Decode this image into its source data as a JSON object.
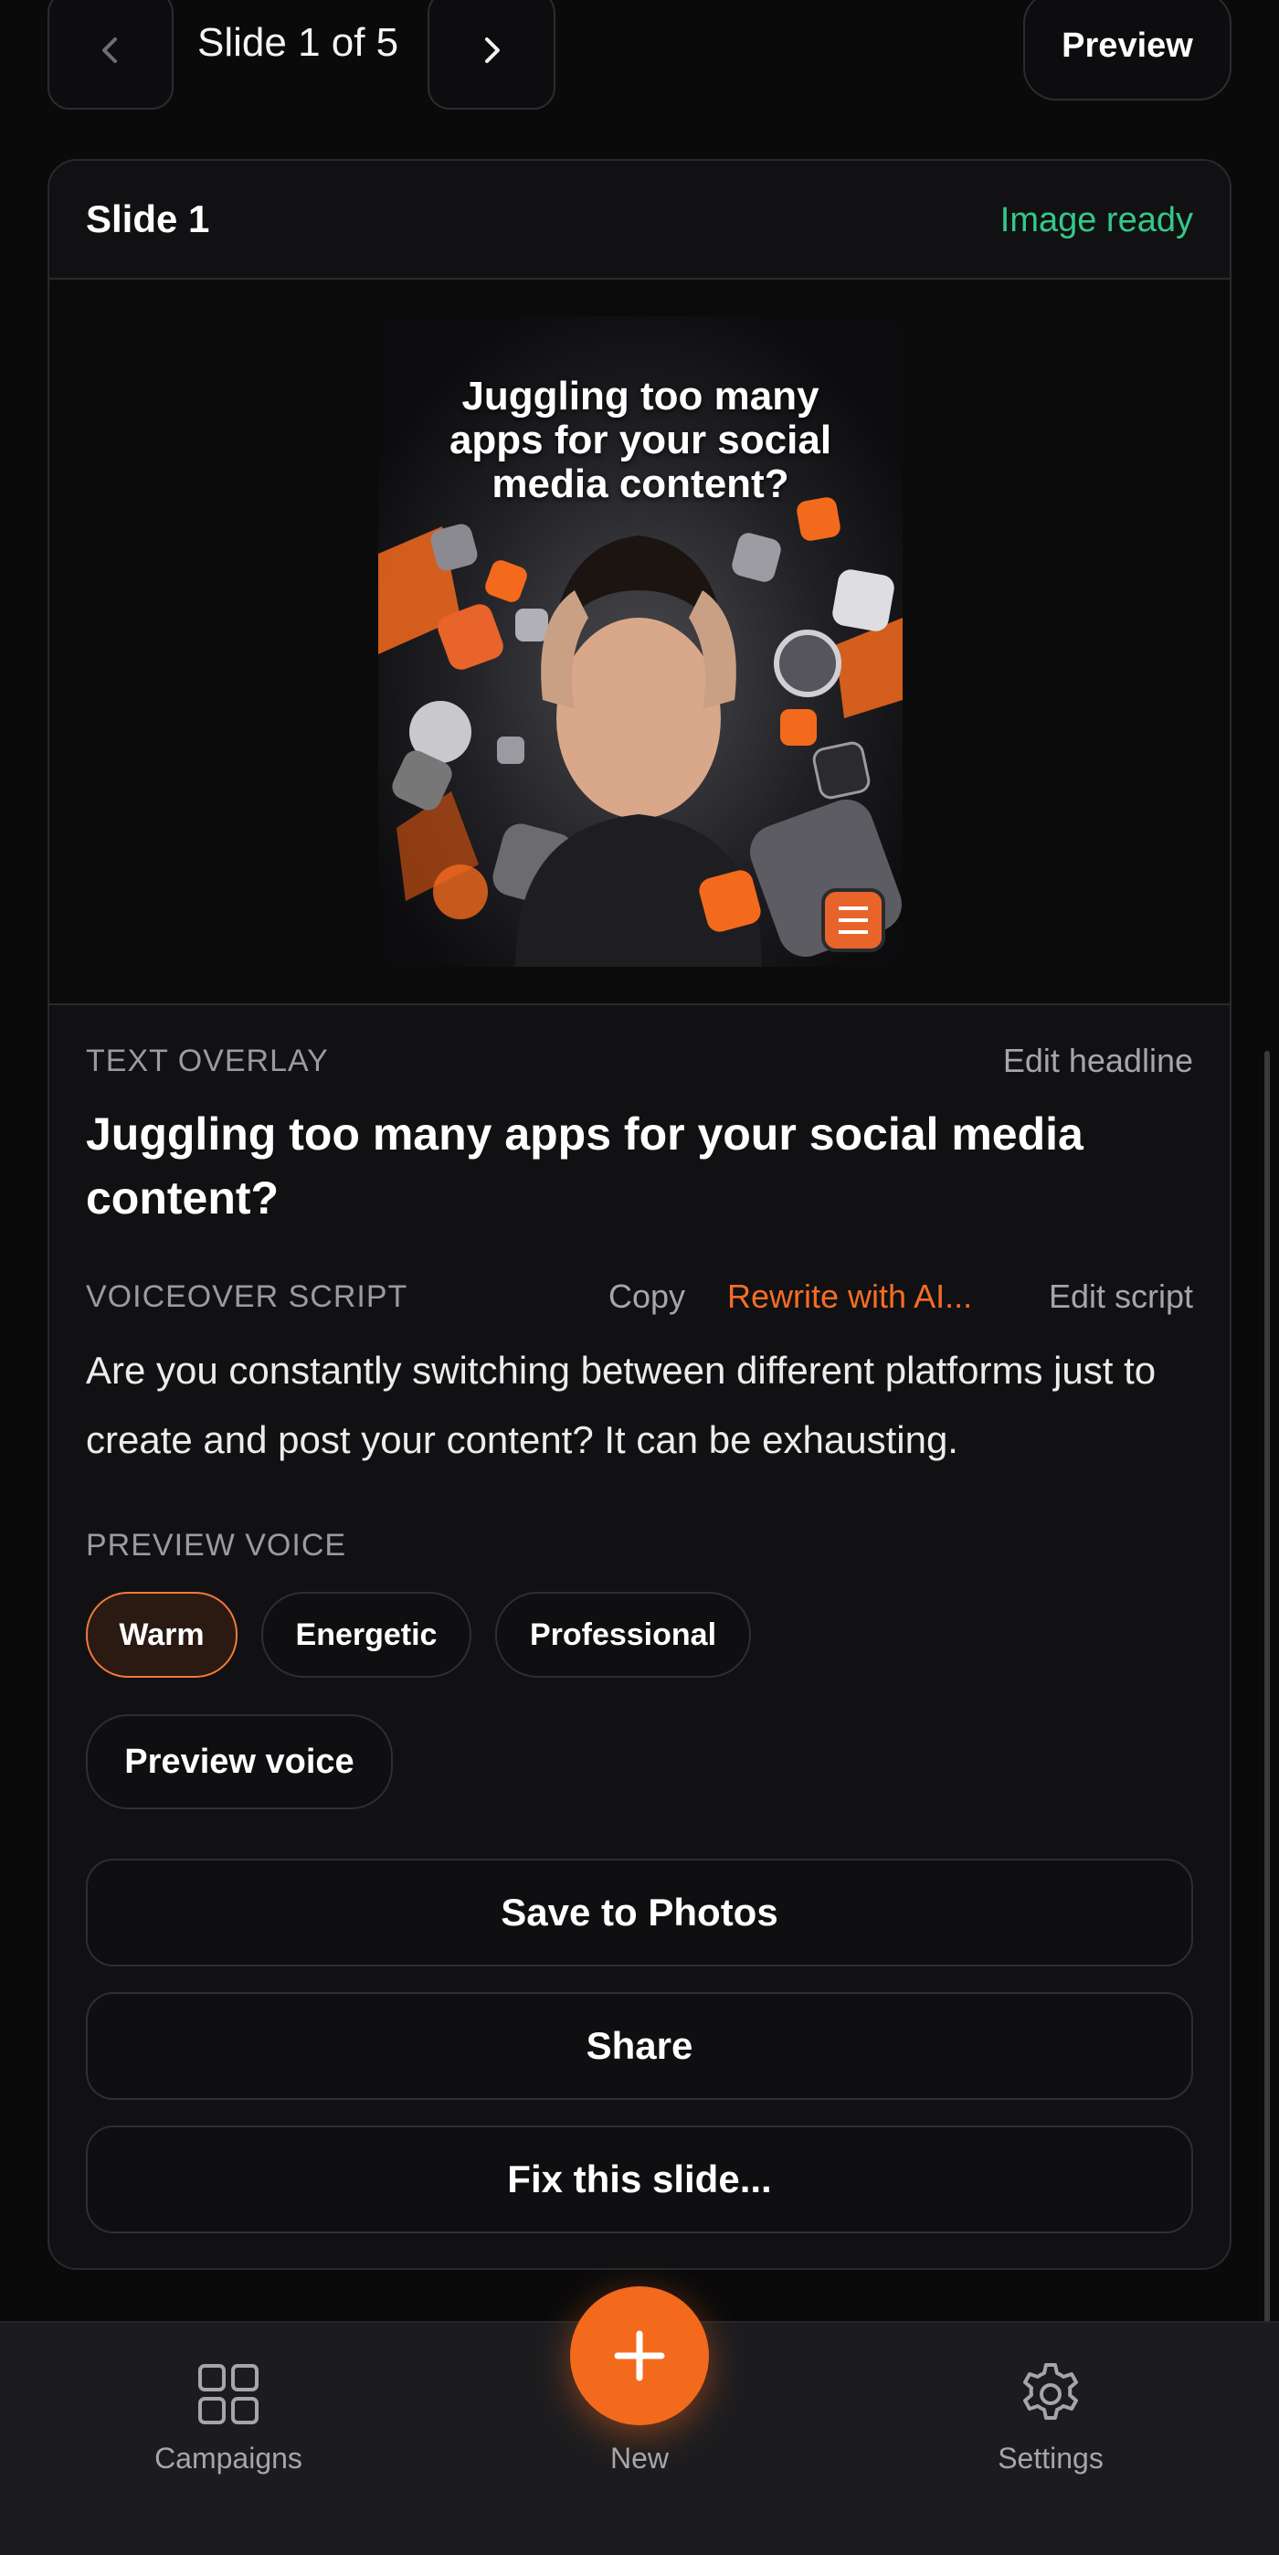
{
  "top_nav": {
    "slide_counter": "Slide 1 of 5",
    "preview_label": "Preview"
  },
  "card": {
    "title": "Slide 1",
    "status": "Image ready",
    "image": {
      "headline": "Juggling too many apps for your social media content?",
      "subject": "stressed-man-surrounded-by-app-icons"
    },
    "text_overlay": {
      "label": "TEXT OVERLAY",
      "edit_label": "Edit headline",
      "headline": "Juggling too many apps for your social media content?"
    },
    "voiceover": {
      "label": "VOICEOVER SCRIPT",
      "copy_label": "Copy",
      "rewrite_label": "Rewrite with AI...",
      "edit_label": "Edit script",
      "script": "Are you constantly switching between different platforms just to create and post your content? It can be exhausting."
    },
    "preview_voice": {
      "label": "PREVIEW VOICE",
      "options": [
        "Warm",
        "Energetic",
        "Professional"
      ],
      "selected": "Warm",
      "button_label": "Preview voice"
    },
    "actions": {
      "save_label": "Save to Photos",
      "share_label": "Share",
      "fix_label": "Fix this slide..."
    }
  },
  "tab_bar": {
    "campaigns_label": "Campaigns",
    "new_label": "New",
    "settings_label": "Settings"
  },
  "colors": {
    "accent": "#f36a1d",
    "status_ready": "#34c98a",
    "background": "#0a0a0b"
  }
}
